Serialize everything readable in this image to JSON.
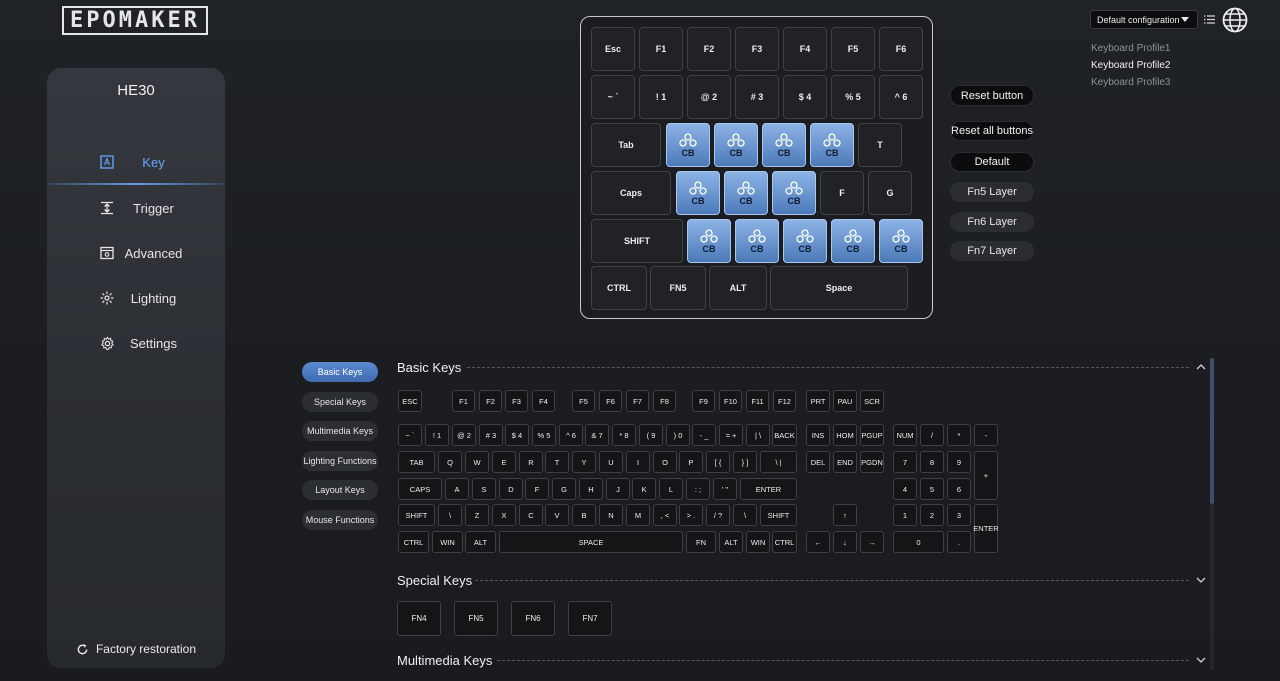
{
  "logo": {
    "text": "EPOMAKER"
  },
  "sidebar": {
    "device": "HE30",
    "items": [
      {
        "label": "Key",
        "icon": "key-icon"
      },
      {
        "label": "Trigger",
        "icon": "trigger-icon"
      },
      {
        "label": "Advanced",
        "icon": "advanced-icon"
      },
      {
        "label": "Lighting",
        "icon": "lighting-icon"
      },
      {
        "label": "Settings",
        "icon": "gear-icon"
      }
    ],
    "active_index": 0,
    "factory_label": "Factory restoration"
  },
  "top_keyboard": {
    "rows": [
      [
        "Esc",
        "F1",
        "F2",
        "F3",
        "F4",
        "F5",
        "F6"
      ],
      [
        "~ `",
        "! 1",
        "@ 2",
        "# 3",
        "$ 4",
        "% 5",
        "^ 6"
      ],
      [
        "Tab",
        "CB",
        "CB",
        "CB",
        "CB",
        "T"
      ],
      [
        "Caps",
        "CB",
        "CB",
        "CB",
        "F",
        "G"
      ],
      [
        "SHIFT",
        "CB",
        "CB",
        "CB",
        "CB",
        "CB"
      ],
      [
        "CTRL",
        "FN5",
        "ALT",
        "Space"
      ]
    ]
  },
  "actions": {
    "reset_button": "Reset button",
    "reset_all": "Reset all buttons",
    "default": "Default",
    "fn5": "Fn5 Layer",
    "fn6": "Fn6 Layer",
    "fn7": "Fn7 Layer"
  },
  "config": {
    "selected": "Default configuration",
    "profiles": [
      "Keyboard Profile1",
      "Keyboard Profile2",
      "Keyboard Profile3"
    ],
    "selected_profile_index": 1
  },
  "categories": [
    "Basic Keys",
    "Special Keys",
    "Multimedia Keys",
    "Lighting Functions",
    "Layout Keys",
    "Mouse Functions"
  ],
  "active_category_index": 0,
  "sections": {
    "basic": "Basic Keys",
    "special": "Special Keys",
    "multimedia": "Multimedia Keys"
  },
  "basic_keys": {
    "row0": [
      "ESC",
      "F1",
      "F2",
      "F3",
      "F4",
      "F5",
      "F6",
      "F7",
      "F8",
      "F9",
      "F10",
      "F11",
      "F12",
      "PRT",
      "PAU",
      "SCR"
    ],
    "row1": [
      "~ `",
      "! 1",
      "@ 2",
      "# 3",
      "$ 4",
      "% 5",
      "^ 6",
      "& 7",
      "* 8",
      "( 9",
      ") 0",
      "- _",
      "= +",
      "| \\",
      "BACK",
      "INS",
      "HOM",
      "PGUP",
      "NUM",
      "/",
      "*",
      "-"
    ],
    "row2": [
      "TAB",
      "Q",
      "W",
      "E",
      "R",
      "T",
      "Y",
      "U",
      "I",
      "O",
      "P",
      "[ {",
      "} ]",
      "\\ |",
      "DEL",
      "END",
      "PGDN",
      "7",
      "8",
      "9",
      "+"
    ],
    "row3": [
      "CAPS",
      "A",
      "S",
      "D",
      "F",
      "G",
      "H",
      "J",
      "K",
      "L",
      ": ;",
      "' \"",
      "ENTER",
      "4",
      "5",
      "6"
    ],
    "row4": [
      "SHIFT",
      "\\",
      "Z",
      "X",
      "C",
      "V",
      "B",
      "N",
      "M",
      ", <",
      "> .",
      "/ ?",
      "\\",
      "SHIFT",
      "↑",
      "1",
      "2",
      "3",
      "ENTER"
    ],
    "row5": [
      "CTRL",
      "WIN",
      "ALT",
      "SPACE",
      "FN",
      "ALT",
      "WIN",
      "CTRL",
      "←",
      "↓",
      "→",
      "0",
      "."
    ]
  },
  "special_keys": [
    "FN4",
    "FN5",
    "FN6",
    "FN7"
  ],
  "colors": {
    "accent": "#6aa6ff",
    "cb_key": "#6d95d0"
  }
}
